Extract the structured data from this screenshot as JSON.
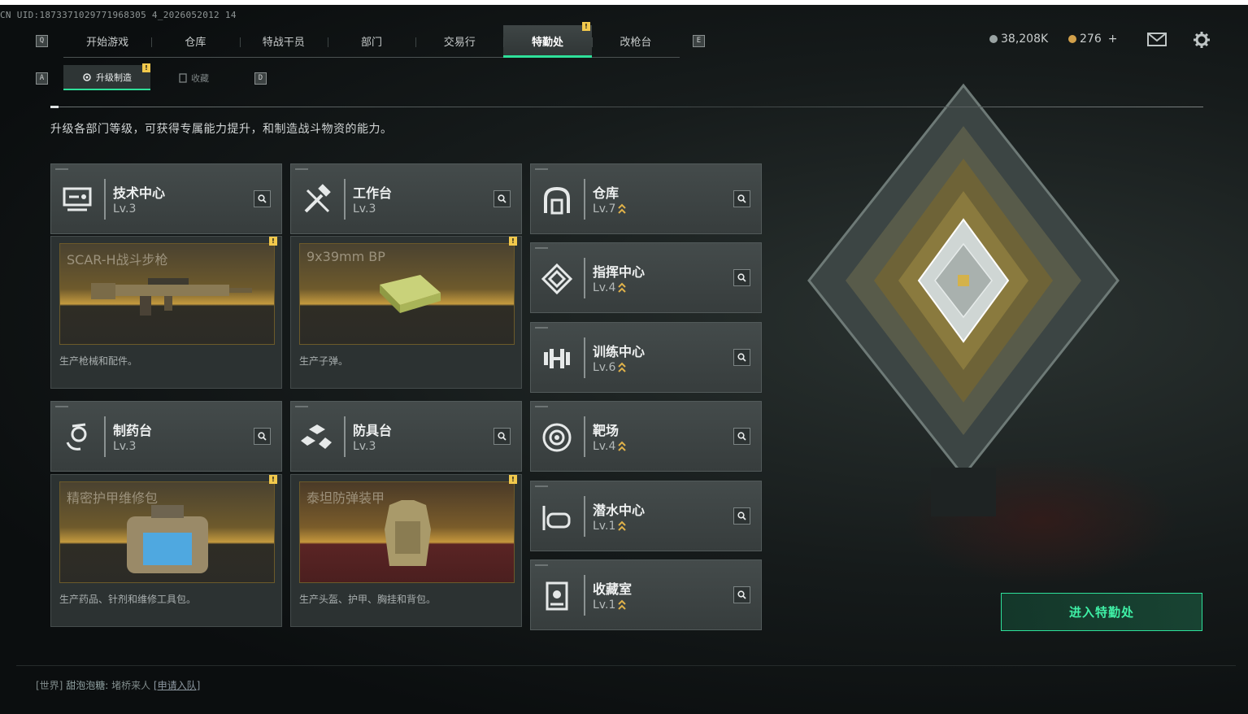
{
  "uid": "CN UID:1873371029771968305 4_2026052012 14",
  "nav": {
    "left_key": "Q",
    "right_key": "E",
    "tabs": [
      "开始游戏",
      "仓库",
      "特战干员",
      "部门",
      "交易行",
      "特勤处",
      "改枪台"
    ],
    "active_tab": "特勤处",
    "alert_mark": "!"
  },
  "resources": {
    "silver": "38,208K",
    "gold": "276",
    "plus": "+"
  },
  "subtabs": {
    "left_key": "A",
    "right_key": "D",
    "items": [
      "升级制造",
      "收藏"
    ],
    "active": "升级制造"
  },
  "description": "升级各部门等级，可获得专属能力提升，和制造战斗物资的能力。",
  "departments": [
    {
      "name": "技术中心",
      "level": "Lv.3",
      "icon": "tech-center-icon",
      "upgradable": false
    },
    {
      "name": "工作台",
      "level": "Lv.3",
      "icon": "workbench-icon",
      "upgradable": false
    },
    {
      "name": "仓库",
      "level": "Lv.7",
      "icon": "warehouse-icon",
      "upgradable": true
    },
    {
      "name": "指挥中心",
      "level": "Lv.4",
      "icon": "command-center-icon",
      "upgradable": true
    },
    {
      "name": "训练中心",
      "level": "Lv.6",
      "icon": "training-center-icon",
      "upgradable": true
    },
    {
      "name": "制药台",
      "level": "Lv.3",
      "icon": "pharmacy-icon",
      "upgradable": false
    },
    {
      "name": "防具台",
      "level": "Lv.3",
      "icon": "armor-bench-icon",
      "upgradable": false
    },
    {
      "name": "靶场",
      "level": "Lv.4",
      "icon": "range-icon",
      "upgradable": true
    },
    {
      "name": "潜水中心",
      "level": "Lv.1",
      "icon": "diving-center-icon",
      "upgradable": true
    },
    {
      "name": "收藏室",
      "level": "Lv.1",
      "icon": "collection-room-icon",
      "upgradable": true
    }
  ],
  "productions": [
    {
      "item": "SCAR-H战斗步枪",
      "desc": "生产枪械和配件。",
      "style": "gold",
      "icon": "rifle-icon"
    },
    {
      "item": "9x39mm BP",
      "desc": "生产子弹。",
      "style": "gold",
      "icon": "ammo-box-icon"
    },
    {
      "item": "精密护甲维修包",
      "desc": "生产药品、针剂和维修工具包。",
      "style": "gold",
      "icon": "repair-kit-icon"
    },
    {
      "item": "泰坦防弹装甲",
      "desc": "生产头盔、护甲、胸挂和背包。",
      "style": "red",
      "icon": "body-armor-icon"
    }
  ],
  "enter_button": "进入特勤处",
  "chat": {
    "channel": "[世界]",
    "user": "甜泡泡糖:",
    "message": "堵桥来人",
    "link": "[申请入队]"
  },
  "colors": {
    "accent": "#2ee09a",
    "alert": "#f2c94c",
    "upgrade": "#e0b24a"
  }
}
